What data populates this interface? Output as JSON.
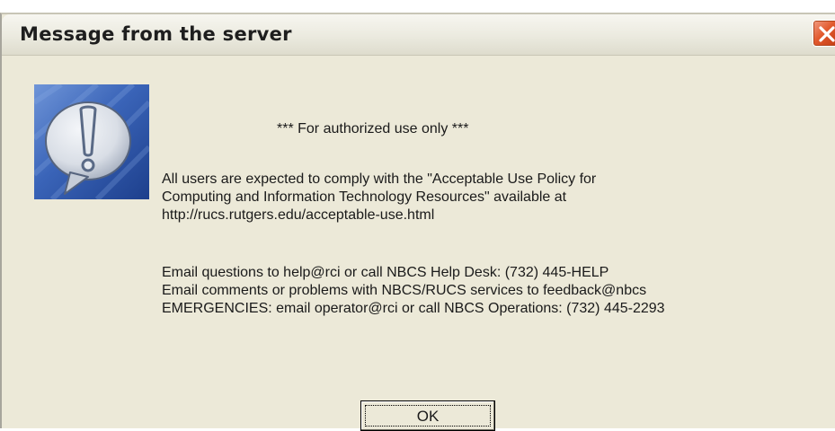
{
  "dialog": {
    "title": "Message from the server",
    "close_label": "X"
  },
  "message": {
    "header": "*** For authorized use only ***",
    "paragraph1": [
      "All users are expected to comply with the \"Acceptable Use Policy for",
      "Computing and Information Technology Resources\" available at",
      "http://rucs.rutgers.edu/acceptable-use.html"
    ],
    "paragraph2": [
      "Email questions to help@rci or call NBCS Help Desk: (732) 445-HELP",
      "Email comments or problems with NBCS/RUCS services to feedback@nbcs",
      "EMERGENCIES: email operator@rci or call NBCS Operations: (732) 445-2293"
    ]
  },
  "buttons": {
    "ok_label": "OK"
  },
  "icon": {
    "name": "exclamation-speech-bubble-icon",
    "colors": {
      "background": "#3a64b8",
      "bubble": "#d9dee6",
      "mark": "#5a6a86"
    }
  }
}
